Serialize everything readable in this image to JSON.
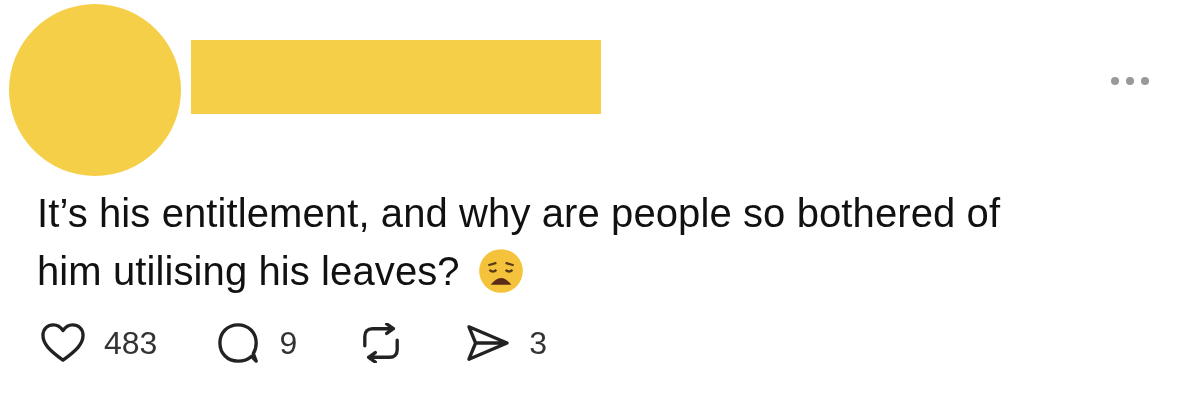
{
  "post": {
    "text_lines": [
      "It’s his entitlement, and why are people so bothered of",
      "him utilising his leaves?"
    ],
    "actions": [
      {
        "kind": "like",
        "count": "483"
      },
      {
        "kind": "reply",
        "count": "9"
      },
      {
        "kind": "repost"
      },
      {
        "kind": "share",
        "count": "3"
      }
    ]
  }
}
